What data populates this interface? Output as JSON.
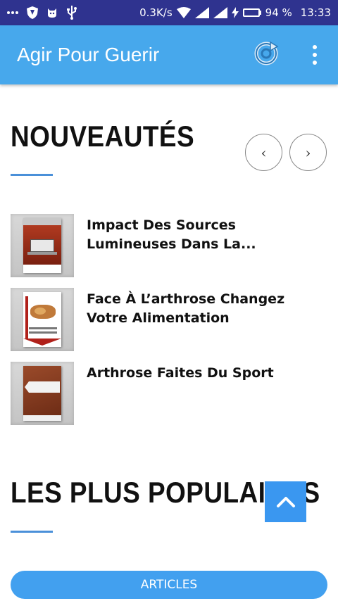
{
  "status_bar": {
    "speed": "0.3K/s",
    "battery_percent": "94 %",
    "battery_level": 0.94,
    "time": "13:33",
    "icons": [
      "more-dots-icon",
      "shield-icon",
      "cat-icon",
      "usb-icon",
      "wifi-icon",
      "signal-icon",
      "signal-icon",
      "charging-icon",
      "battery-icon"
    ]
  },
  "app_bar": {
    "title": "Agir Pour Guerir",
    "refresh_icon": "refresh-icon",
    "menu_icon": "overflow-menu-icon"
  },
  "sections": {
    "new": {
      "title": "NOUVEAUTÉS",
      "prev_label": "‹",
      "next_label": "›"
    },
    "popular": {
      "title": "LES PLUS POPULAIRES"
    }
  },
  "items": [
    {
      "title": "Impact Des Sources Lumineuses Dans La..."
    },
    {
      "title": "Face À L’arthrose Changez Votre Alimentation"
    },
    {
      "title": "Arthrose Faites Du Sport"
    }
  ],
  "scroll_top_icon": "chevron-up-icon",
  "articles_button": "ARTICLES",
  "colors": {
    "status_bar": "#2f338f",
    "app_bar": "#47a8ec",
    "accent": "#4a90d9",
    "button": "#42a0ef"
  }
}
